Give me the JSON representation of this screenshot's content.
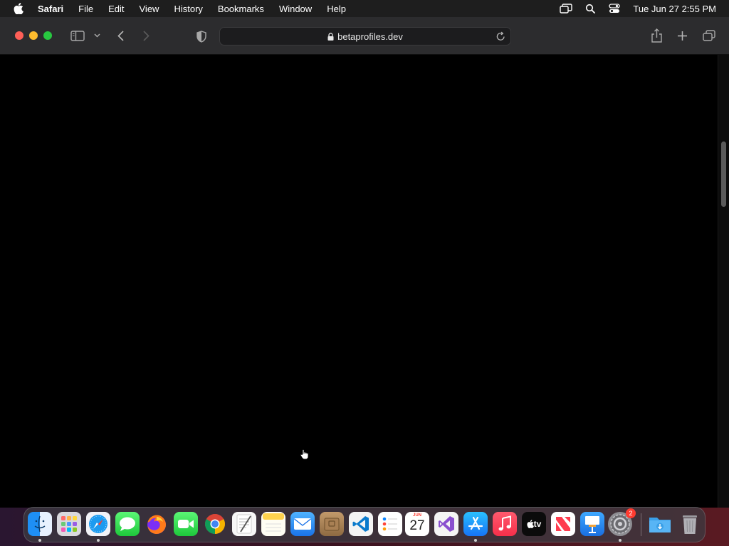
{
  "menubar": {
    "app_name": "Safari",
    "menus": [
      "File",
      "Edit",
      "View",
      "History",
      "Bookmarks",
      "Window",
      "Help"
    ],
    "clock": "Tue Jun 27  2:55 PM"
  },
  "browser": {
    "url": "betaprofiles.dev",
    "page_background": "#000000"
  },
  "dock": {
    "calendar": {
      "month": "JUN",
      "day": "27"
    },
    "appletv_label": "tv",
    "settings_badge": "2",
    "apps": [
      "Finder",
      "Launchpad",
      "Safari",
      "Messages",
      "Firefox",
      "FaceTime",
      "Chrome",
      "TextEdit",
      "Notes",
      "Mail",
      "Archive",
      "Visual Studio Code",
      "Reminders",
      "Calendar",
      "Visual Studio",
      "App Store",
      "Music",
      "Apple TV",
      "News",
      "Keynote",
      "System Settings",
      "Downloads",
      "Trash"
    ]
  }
}
